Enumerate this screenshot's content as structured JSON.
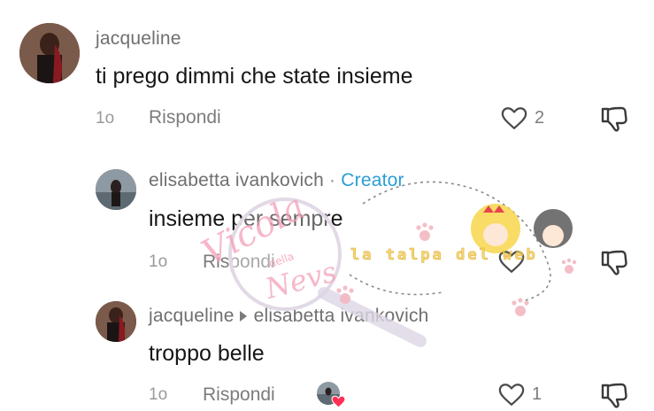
{
  "comments": [
    {
      "username": "jacqueline",
      "text": "ti prego dimmi che state insieme",
      "time": "1o",
      "reply_label": "Rispondi",
      "likes": "2"
    },
    {
      "username": "elisabetta ivankovich",
      "separator": "·",
      "badge": "Creator",
      "text": "insieme per sempre",
      "time": "1o",
      "reply_label": "Rispondi"
    },
    {
      "username": "jacqueline",
      "reply_to": "elisabetta ivankovich",
      "text": "troppo belle",
      "time": "1o",
      "reply_label": "Rispondi",
      "likes": "1"
    }
  ],
  "watermark": {
    "line1": "Vicola",
    "line2": "della",
    "line3": "Nevs",
    "banner": "la talpa del web"
  },
  "colors": {
    "creator": "#2b9ed6",
    "heart_badge": "#ff2f55"
  }
}
